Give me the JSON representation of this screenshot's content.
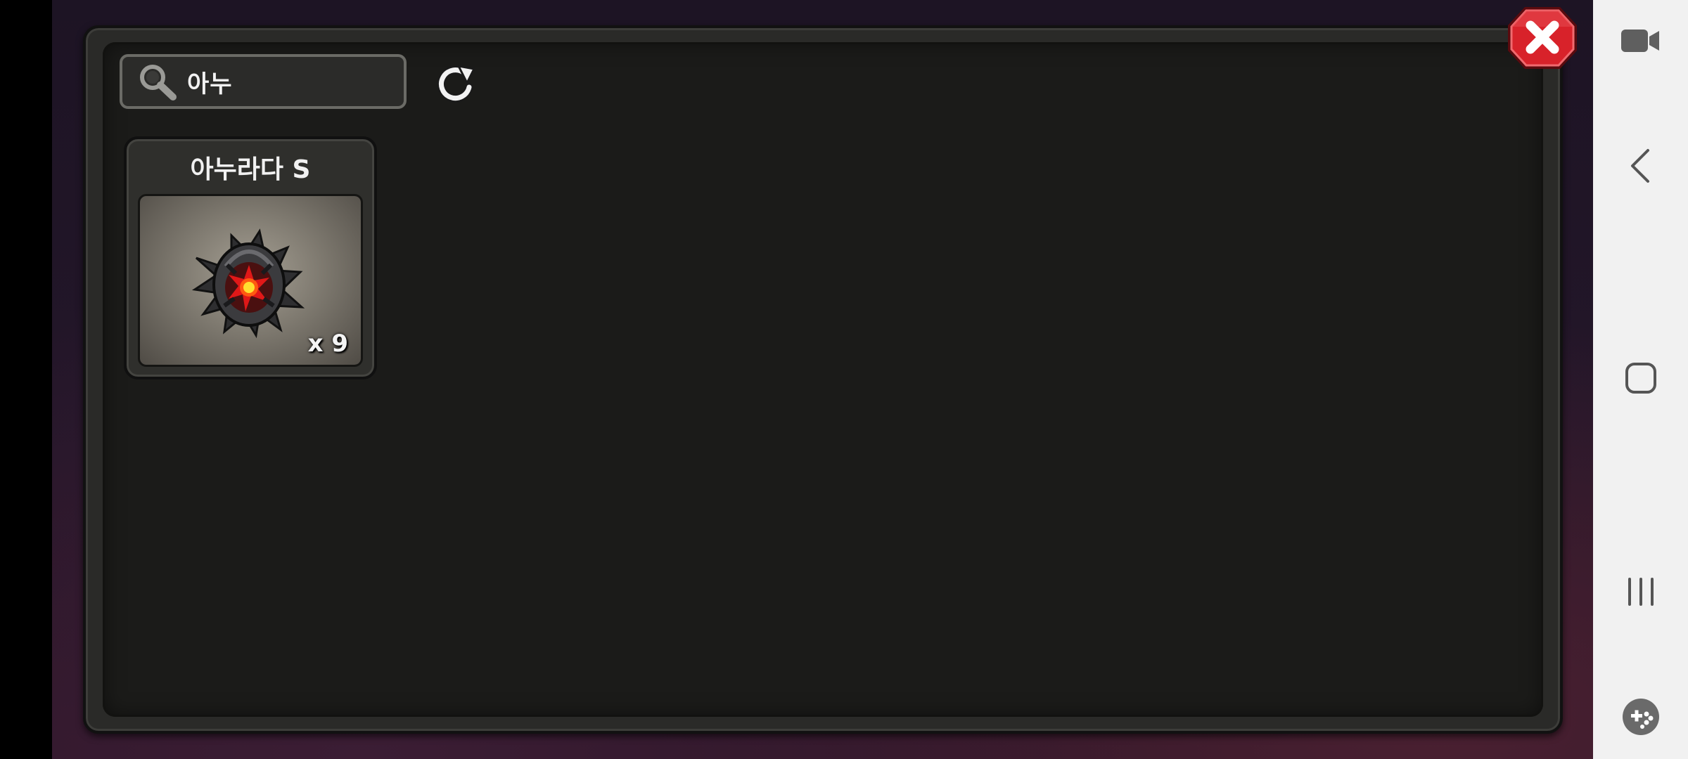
{
  "search": {
    "query": "아누",
    "icon": "search-icon"
  },
  "toolbar": {
    "refresh_icon": "refresh-icon",
    "close_icon": "close-icon"
  },
  "results": [
    {
      "name": "아누라다 S",
      "quantity": "x 9",
      "image_icon": "dark-egg-item-icon"
    }
  ],
  "nav_bar": {
    "items": [
      "video-camera-icon",
      "back-icon",
      "home-icon",
      "recent-apps-icon",
      "game-tools-icon"
    ]
  },
  "colors": {
    "panel": "#2a2a28",
    "panel_inner": "#1b1b19",
    "close_red": "#d8222a",
    "nav_bg": "#f1f1f1"
  }
}
